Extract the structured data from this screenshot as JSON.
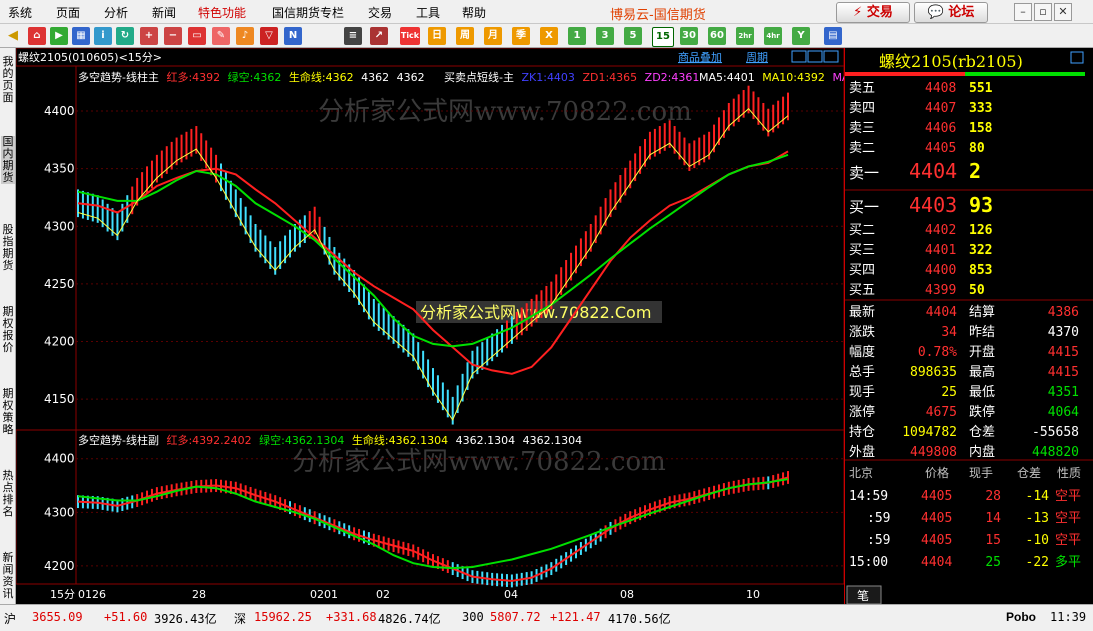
{
  "menu": {
    "items": [
      "系统",
      "页面",
      "分析",
      "新闻",
      "特色功能",
      "国信期货专栏",
      "交易",
      "工具",
      "帮助"
    ],
    "brand": "博易云-国信期货",
    "trade_btn": "交易",
    "forum_btn": "论坛"
  },
  "toolbar": {
    "text_buttons": [
      "Tick",
      "日",
      "周",
      "月",
      "季",
      "X",
      "1",
      "3",
      "5",
      "15",
      "30",
      "60",
      "2hr",
      "4hr",
      "Y"
    ]
  },
  "sidebar": {
    "items": [
      "我的页面",
      "国内期货",
      "股指期货",
      "期权报价",
      "期权策略",
      "热点排名",
      "新闻资讯"
    ]
  },
  "chart_header": {
    "symbol": "螺纹2105(010605)<15分>",
    "overlay_link": "商品叠加",
    "period_link": "周期"
  },
  "main_legend": {
    "name": "多空趋势-线柱主",
    "red_label": "红多:4392",
    "green_label": "绿空:4362",
    "life_label": "生命线:4362",
    "v1": "4362",
    "v2": "4362",
    "sig_name": "买卖点短线-主",
    "zk1": "ZK1:4403",
    "zd1": "ZD1:4365",
    "zd2": "ZD2:4361",
    "ma5": "MA5:4401",
    "ma10": "MA10:4392",
    "ma_more": "MA"
  },
  "sub_legend": {
    "name": "多空趋势-线柱副",
    "red_label": "红多:4392.2402",
    "green_label": "绿空:4362.1304",
    "life_label": "生命线:4362.1304",
    "v1": "4362.1304",
    "v2": "4362.1304"
  },
  "watermarks": {
    "main": "分析家公式网www.70822.com",
    "center": "分析家公式网www.70822.Com",
    "sub": "分析家公式网www.70822.com"
  },
  "x_axis": {
    "period_label": "15分",
    "labels": [
      "0126",
      "28",
      "0201",
      "02",
      "04",
      "08",
      "10"
    ]
  },
  "chart_data": {
    "type": "line",
    "title": "螺纹2105(010605)<15分>",
    "panels": [
      {
        "name": "多空趋势-线柱主",
        "ylim": [
          4125,
          4420
        ],
        "yticks": [
          4150,
          4200,
          4250,
          4300,
          4350,
          4400
        ],
        "series": [
          {
            "name": "红多",
            "color": "#ff2020",
            "values": [
              4320,
              4318,
              4312,
              4322,
              4335,
              4342,
              4348,
              4350,
              4345,
              4332,
              4320,
              4305,
              4290,
              4275,
              4260,
              4248,
              4238,
              4228,
              4210,
              4195,
              4180,
              4175,
              4172,
              4178,
              4195,
              4220,
              4245,
              4270,
              4290,
              4305,
              4318,
              4325,
              4335,
              4345,
              4352,
              4355,
              4365
            ]
          },
          {
            "name": "绿空",
            "color": "#00e000",
            "values": [
              4330,
              4326,
              4322,
              4322,
              4330,
              4340,
              4348,
              4345,
              4335,
              4320,
              4310,
              4300,
              4288,
              4272,
              4256,
              4240,
              4220,
              4205,
              4198,
              4196,
              4198,
              4205,
              4212,
              4222,
              4232,
              4245,
              4258,
              4272,
              4285,
              4298,
              4310,
              4322,
              4334,
              4345,
              4352,
              4356,
              4362
            ]
          },
          {
            "name": "收盘",
            "color": "#ffffff",
            "values": [
              4320,
              4315,
              4300,
              4330,
              4350,
              4365,
              4375,
              4350,
              4320,
              4290,
              4270,
              4290,
              4305,
              4270,
              4250,
              4225,
              4210,
              4195,
              4165,
              4140,
              4180,
              4195,
              4210,
              4225,
              4240,
              4265,
              4290,
              4320,
              4345,
              4370,
              4380,
              4360,
              4370,
              4395,
              4410,
              4390,
              4404
            ]
          }
        ]
      },
      {
        "name": "多空趋势-线柱副",
        "ylim": [
          4170,
          4420
        ],
        "yticks": [
          4200,
          4300,
          4400
        ],
        "series": [
          {
            "name": "红多",
            "color": "#ff2020",
            "values": [
              4320,
              4318,
              4312,
              4322,
              4335,
              4342,
              4348,
              4350,
              4345,
              4332,
              4320,
              4305,
              4290,
              4275,
              4260,
              4248,
              4238,
              4228,
              4210,
              4195,
              4180,
              4175,
              4172,
              4178,
              4195,
              4220,
              4245,
              4270,
              4290,
              4305,
              4318,
              4325,
              4335,
              4345,
              4352,
              4355,
              4365
            ]
          },
          {
            "name": "绿空",
            "color": "#00e000",
            "values": [
              4330,
              4326,
              4322,
              4322,
              4330,
              4340,
              4348,
              4345,
              4335,
              4320,
              4310,
              4300,
              4288,
              4272,
              4256,
              4240,
              4220,
              4205,
              4198,
              4196,
              4198,
              4205,
              4212,
              4222,
              4232,
              4245,
              4258,
              4272,
              4285,
              4298,
              4310,
              4322,
              4334,
              4345,
              4352,
              4356,
              4362
            ]
          }
        ]
      }
    ]
  },
  "quote": {
    "title": "螺纹2105(rb2105)",
    "asks": [
      {
        "label": "卖五",
        "price": "4408",
        "vol": "551"
      },
      {
        "label": "卖四",
        "price": "4407",
        "vol": "333"
      },
      {
        "label": "卖三",
        "price": "4406",
        "vol": "158"
      },
      {
        "label": "卖二",
        "price": "4405",
        "vol": "80"
      },
      {
        "label": "卖一",
        "price": "4404",
        "vol": "2"
      }
    ],
    "bids": [
      {
        "label": "买一",
        "price": "4403",
        "vol": "93"
      },
      {
        "label": "买二",
        "price": "4402",
        "vol": "126"
      },
      {
        "label": "买三",
        "price": "4401",
        "vol": "322"
      },
      {
        "label": "买四",
        "price": "4400",
        "vol": "853"
      },
      {
        "label": "买五",
        "price": "4399",
        "vol": "50"
      }
    ],
    "stats": [
      {
        "l1": "最新",
        "v1": "4404",
        "c1": "#ff3030",
        "l2": "结算",
        "v2": "4386",
        "c2": "#ff3030"
      },
      {
        "l1": "涨跌",
        "v1": "34",
        "c1": "#ff3030",
        "l2": "昨结",
        "v2": "4370",
        "c2": "#ffffff"
      },
      {
        "l1": "幅度",
        "v1": "0.78%",
        "c1": "#ff3030",
        "l2": "开盘",
        "v2": "4415",
        "c2": "#ff3030"
      },
      {
        "l1": "总手",
        "v1": "898635",
        "c1": "#ffff00",
        "l2": "最高",
        "v2": "4415",
        "c2": "#ff3030"
      },
      {
        "l1": "现手",
        "v1": "25",
        "c1": "#ffff00",
        "l2": "最低",
        "v2": "4351",
        "c2": "#00e000"
      },
      {
        "l1": "涨停",
        "v1": "4675",
        "c1": "#ff3030",
        "l2": "跌停",
        "v2": "4064",
        "c2": "#00e000"
      },
      {
        "l1": "持仓",
        "v1": "1094782",
        "c1": "#ffff00",
        "l2": "仓差",
        "v2": "-55658",
        "c2": "#ffffff"
      },
      {
        "l1": "外盘",
        "v1": "449808",
        "c1": "#ff3030",
        "l2": "内盘",
        "v2": "448820",
        "c2": "#00e000"
      }
    ],
    "tick_header": {
      "loc": "北京",
      "price": "价格",
      "vol": "现手",
      "oi": "仓差",
      "nature": "性质"
    },
    "ticks": [
      {
        "time": "14:59",
        "price": "4405",
        "vol": "28",
        "oi": "-14",
        "nature": "空平"
      },
      {
        "time": ":59",
        "price": "4405",
        "vol": "14",
        "oi": "-13",
        "nature": "空平"
      },
      {
        "time": ":59",
        "price": "4405",
        "vol": "15",
        "oi": "-10",
        "nature": "空平"
      },
      {
        "time": "15:00",
        "price": "4404",
        "vol": "25",
        "oi": "-22",
        "nature": "多平"
      }
    ],
    "tab": "笔"
  },
  "statusbar": {
    "sh_label": "沪",
    "sh_val": "3655.09",
    "sh_chg": "+51.60",
    "sh_amt": "3926.43亿",
    "sz_label": "深",
    "sz_val": "15962.25",
    "sz_chg": "+331.68",
    "sz_amt": "4826.74亿",
    "i300_label": "300",
    "i300_val": "5807.72",
    "i300_chg": "+121.47",
    "i300_amt": "4170.56亿",
    "pobo": "Pobo",
    "time": "11:39"
  },
  "colors": {
    "up": "#ff3030",
    "down": "#00e000",
    "cyan": "#40e0ff",
    "yellow": "#ffff00",
    "grid": "#8b0000"
  }
}
